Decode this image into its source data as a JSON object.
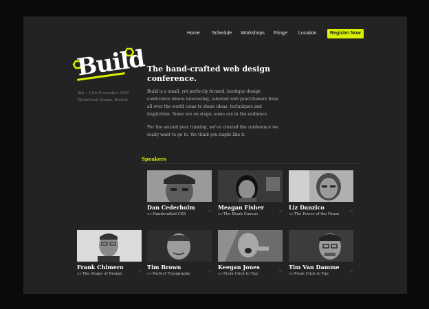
{
  "nav": {
    "items": [
      "Home",
      "Schedule",
      "Workshops",
      "Fringe",
      "Location"
    ],
    "register_label": "Register Now"
  },
  "logo": {
    "text": "Build"
  },
  "event": {
    "dates": "8th – 12th November 2010",
    "venue": "Waterfront Studio, Belfast"
  },
  "intro": {
    "headline": "The hand-crafted web design conference.",
    "paragraph_1": "Build is a small, yet perfectly formed, boutique design conference where interesting, talented web practitioners from all over the world come to share ideas, techniques and inspiration. Some are on stage; some are in the audience.",
    "paragraph_2": "For the second year running, we've created the conference we really want to go to. We think you might like it."
  },
  "speakers": {
    "heading": "Speakers",
    "on_label": "on",
    "list": [
      {
        "name": "Dan Cederholm",
        "talk": "Handcrafted CSS"
      },
      {
        "name": "Meagan Fisher",
        "talk": "The Blank Canvas"
      },
      {
        "name": "Liz Danzico",
        "talk": "The Power of the Pause"
      },
      {
        "name": "Frank Chimero",
        "talk": "The Shape of Design"
      },
      {
        "name": "Tim Brown",
        "talk": "Perfect Typography"
      },
      {
        "name": "Keegan Jones",
        "talk": "From Click to Tap"
      },
      {
        "name": "Tim Van Damme",
        "talk": "From Click to Tap"
      }
    ]
  },
  "colors": {
    "background": "#232323",
    "outer": "#0a0a0a",
    "accent": "#d8f000",
    "text": "#ffffff",
    "muted": "#7e7e7e"
  }
}
